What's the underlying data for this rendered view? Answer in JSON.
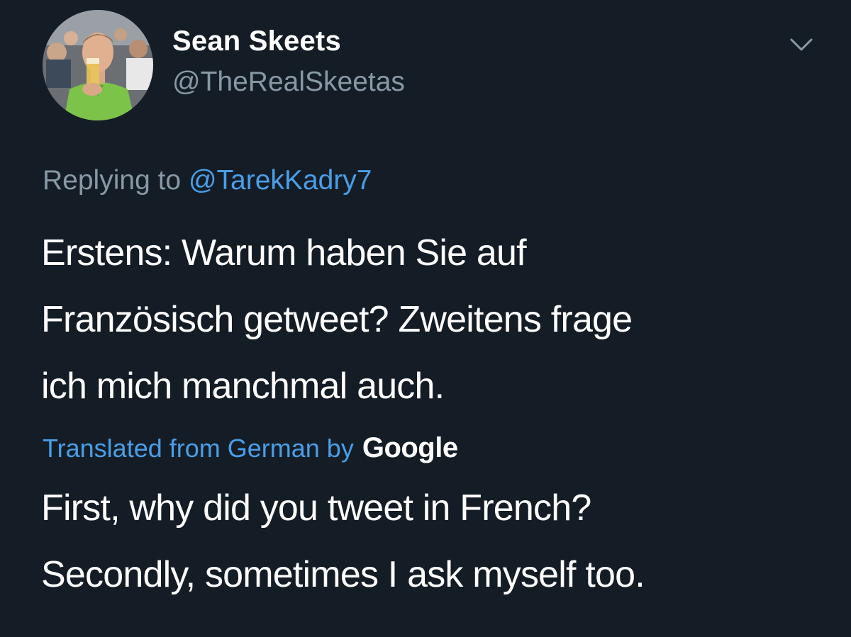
{
  "user": {
    "display_name": "Sean Skeets",
    "handle": "@TheRealSkeetas",
    "avatar_icon": "profile-photo"
  },
  "header": {
    "menu_icon": "chevron-down-icon"
  },
  "reply": {
    "prefix": "Replying to",
    "mention": "@TarekKadry7"
  },
  "tweet": {
    "text_lines": [
      "Erstens: Warum haben Sie auf",
      "Französisch getweet? Zweitens frage",
      "ich mich manchmal auch."
    ]
  },
  "translation": {
    "credit_label": "Translated from German by",
    "provider": "Google",
    "text_lines": [
      "First, why did you tweet in French?",
      "Secondly, sometimes I ask myself too."
    ]
  },
  "colors": {
    "background": "#141d26",
    "primary_text": "#ffffff",
    "secondary_text": "#8899a6",
    "link": "#4a9ee8"
  }
}
